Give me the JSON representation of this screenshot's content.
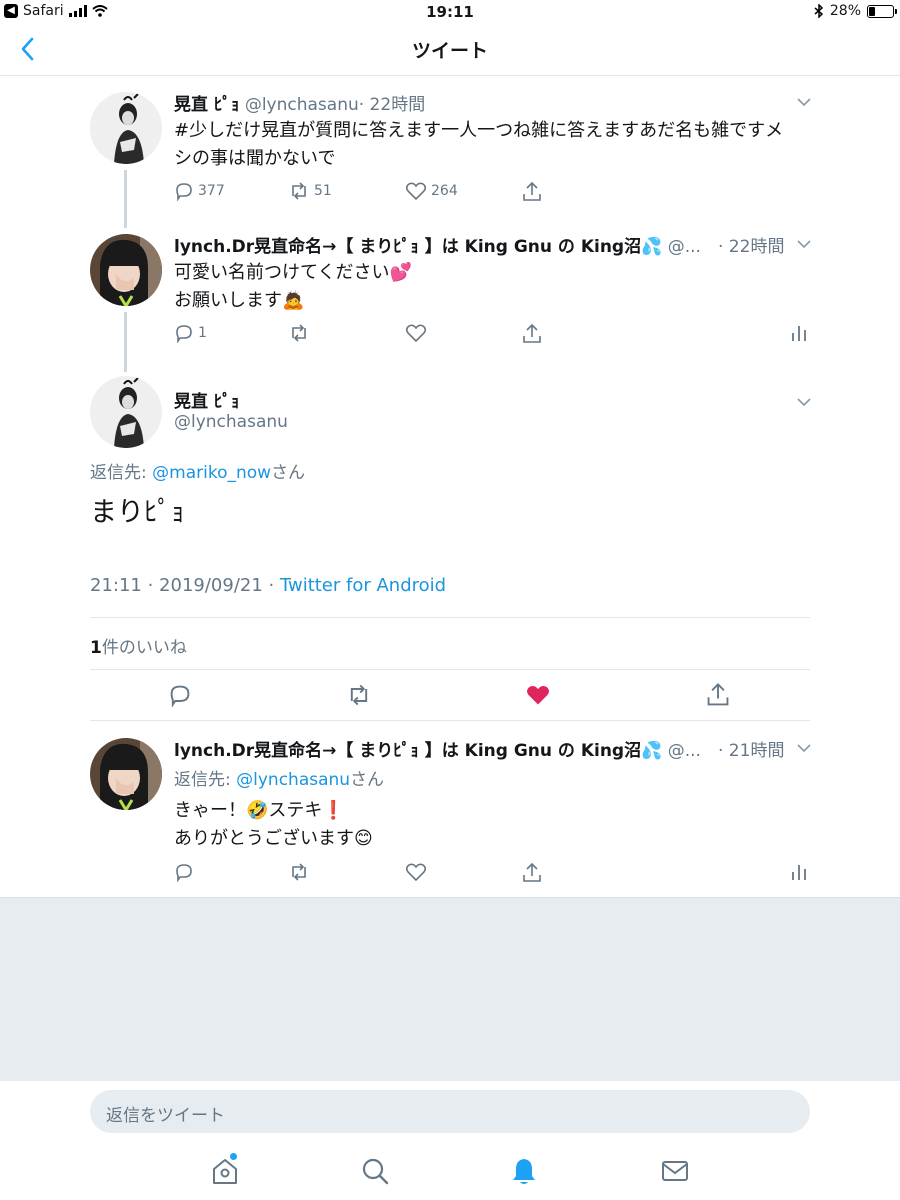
{
  "status_bar": {
    "back_app": "Safari",
    "time": "19:11",
    "battery": "28%",
    "battery_level": 0.28
  },
  "nav": {
    "title": "ツイート"
  },
  "tweet1": {
    "name": "晃直 ﾋﾟｮ",
    "handle": "@lynchasanu",
    "time": "· 22時間",
    "text_line1": "#少しだけ晃直が質問に答えます一人一つね雑に答えますあだ名も雑ですメ",
    "text_line2": "シの事は聞かないで",
    "replies": "377",
    "retweets": "51",
    "likes": "264"
  },
  "tweet2": {
    "name": "lynch.Dr晃直命名→【 まりﾋﾟｮ 】は King Gnu の King沼💦",
    "handle": "@...",
    "time": "· 22時間",
    "text_line1": "可愛い名前つけてください💕",
    "text_line2": "お願いします🙇",
    "replies": "1"
  },
  "main_tweet": {
    "name": "晃直 ﾋﾟｮ",
    "handle": "@lynchasanu",
    "reply_to_label": "返信先: ",
    "reply_to_user": "@mariko_now",
    "reply_to_suffix": "さん",
    "text": "まりﾋﾟｮ",
    "timestamp": "21:11 · 2019/09/21 · ",
    "source": "Twitter for Android",
    "likes_count": "1",
    "likes_label": "件のいいね"
  },
  "tweet3": {
    "name": "lynch.Dr晃直命名→【 まりﾋﾟｮ 】は King Gnu の King沼💦",
    "handle": "@...",
    "time": "· 21時間",
    "reply_to_label": "返信先: ",
    "reply_to_user": "@lynchasanu",
    "reply_to_suffix": "さん",
    "text_line1": "きゃー！🤣ステキ❗",
    "text_line2": "ありがとうございます😊"
  },
  "reply_box": {
    "placeholder": "返信をツイート"
  },
  "tabs": [
    "home-icon",
    "search-icon",
    "notifications-icon",
    "messages-icon"
  ],
  "colors": {
    "accent": "#1da1f2",
    "link": "#1b95e0",
    "like": "#e0245e",
    "muted": "#657786",
    "background": "#e6ecf0"
  }
}
